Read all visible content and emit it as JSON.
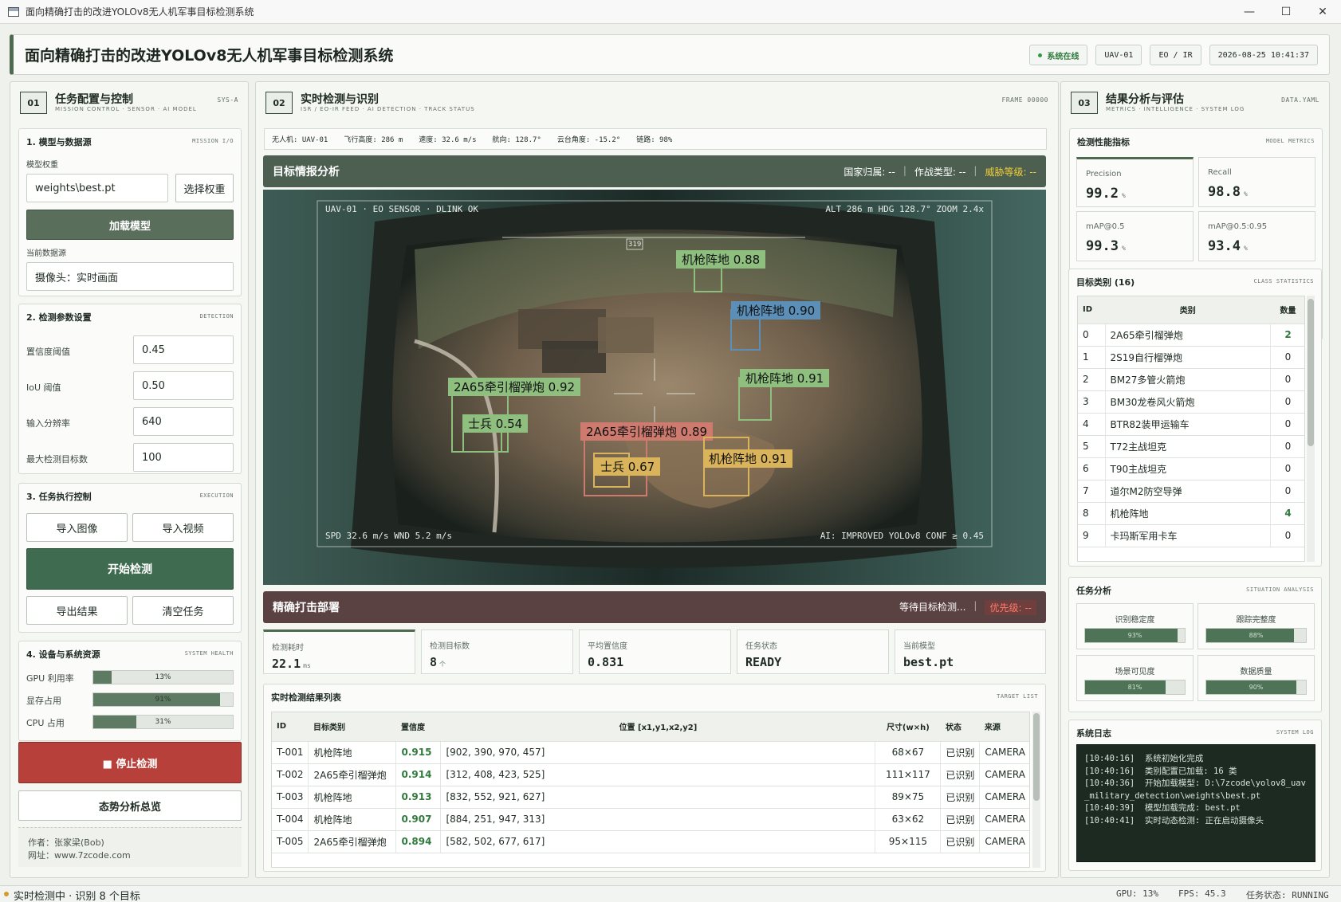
{
  "window": {
    "title": "面向精确打击的改进YOLOv8无人机军事目标检测系统"
  },
  "header": {
    "title": "面向精确打击的改进YOLOv8无人机军事目标检测系统",
    "status": "系统在线",
    "uav": "UAV-01",
    "sensor": "EO / IR",
    "datetime": "2026-08-25 10:41:37"
  },
  "left": {
    "num": "01",
    "title": "任务配置与控制",
    "subtitle": "MISSION CONTROL · SENSOR · AI MODEL",
    "tag": "SYS-A",
    "model": {
      "title": "1. 模型与数据源",
      "tag": "MISSION I/O",
      "weights_label": "模型权重",
      "weights_value": "weights\\best.pt",
      "choose_btn": "选择权重",
      "load_btn": "加载模型",
      "source_label": "当前数据源",
      "source_value": "摄像头：实时画面"
    },
    "params": {
      "title": "2. 检测参数设置",
      "tag": "DETECTION",
      "items": [
        {
          "label": "置信度阈值",
          "value": "0.45"
        },
        {
          "label": "IoU 阈值",
          "value": "0.50"
        },
        {
          "label": "输入分辨率",
          "value": "640"
        },
        {
          "label": "最大检测目标数",
          "value": "100"
        }
      ]
    },
    "exec": {
      "title": "3. 任务执行控制",
      "tag": "EXECUTION",
      "import_image": "导入图像",
      "import_video": "导入视频",
      "start": "开始检测",
      "export": "导出结果",
      "clear": "清空任务"
    },
    "device": {
      "title": "4. 设备与系统资源",
      "tag": "SYSTEM HEALTH",
      "items": [
        {
          "label": "GPU 利用率",
          "value": 0.13,
          "text": "13%"
        },
        {
          "label": "显存占用",
          "value": 0.91,
          "text": "91%"
        },
        {
          "label": "CPU 占用",
          "value": 0.31,
          "text": "31%"
        }
      ]
    },
    "stop_btn": "■ 停止检测",
    "overview_btn": "态势分析总览",
    "author": "作者：张家梁(Bob)",
    "website": "网址：www.7zcode.com"
  },
  "center": {
    "num": "02",
    "title": "实时检测与识别",
    "subtitle": "ISR / EO-IR FEED · AI DETECTION · TRACK STATUS",
    "tag": "FRAME 00000",
    "telemetry": [
      "无人机: UAV-01",
      "飞行高度: 286 m",
      "速度: 32.6 m/s",
      "航向: 128.7°",
      "云台角度: -15.2°",
      "链路: 98%"
    ],
    "intel": {
      "title": "目标情报分析",
      "nation": "国家归属: --",
      "combat": "作战类型: --",
      "threat": "威胁等级: --"
    },
    "hud": {
      "tl": "UAV-01 · EO SENSOR · DLINK OK",
      "tr": "ALT 286 m   HDG 128.7°   ZOOM 2.4x",
      "bl": "SPD 32.6 m/s   WND 5.2 m/s",
      "br": "AI: IMPROVED YOLOv8   CONF ≥ 0.45",
      "heading_box": "319"
    },
    "detections": [
      {
        "label": "机枪阵地  0.88",
        "color": "#8fbf7f"
      },
      {
        "label": "机枪阵地  0.90",
        "color": "#5b8fb7"
      },
      {
        "label": "机枪阵地  0.91",
        "color": "#8fbf7f"
      },
      {
        "label": "2A65牵引榴弹炮  0.92",
        "color": "#8fbf7f"
      },
      {
        "label": "士兵  0.54",
        "color": "#8fbf7f"
      },
      {
        "label": "2A65牵引榴弹炮  0.89",
        "color": "#cf7a6e"
      },
      {
        "label": "士兵  0.67",
        "color": "#d9b45a"
      },
      {
        "label": "机枪阵地  0.91",
        "color": "#d9b45a"
      }
    ],
    "strike": {
      "title": "精确打击部署",
      "waiting": "等待目标检测...",
      "priority": "优先级: --"
    },
    "stats": [
      {
        "k": "检测耗时",
        "v": "22.1",
        "u": "ms"
      },
      {
        "k": "检测目标数",
        "v": "8",
        "u": "个"
      },
      {
        "k": "平均置信度",
        "v": "0.831",
        "u": ""
      },
      {
        "k": "任务状态",
        "v": "READY",
        "u": ""
      },
      {
        "k": "当前模型",
        "v": "best.pt",
        "u": ""
      }
    ],
    "results": {
      "title": "实时检测结果列表",
      "tag": "TARGET LIST",
      "headers": [
        "ID",
        "目标类别",
        "置信度",
        "位置 [x1,y1,x2,y2]",
        "尺寸(w×h)",
        "状态",
        "来源"
      ],
      "rows": [
        [
          "T-001",
          "机枪阵地",
          "0.915",
          "[902, 390, 970, 457]",
          "68×67",
          "已识别",
          "CAMERA"
        ],
        [
          "T-002",
          "2A65牵引榴弹炮",
          "0.914",
          "[312, 408, 423, 525]",
          "111×117",
          "已识别",
          "CAMERA"
        ],
        [
          "T-003",
          "机枪阵地",
          "0.913",
          "[832, 552, 921, 627]",
          "89×75",
          "已识别",
          "CAMERA"
        ],
        [
          "T-004",
          "机枪阵地",
          "0.907",
          "[884, 251, 947, 313]",
          "63×62",
          "已识别",
          "CAMERA"
        ],
        [
          "T-005",
          "2A65牵引榴弹炮",
          "0.894",
          "[582, 502, 677, 617]",
          "95×115",
          "已识别",
          "CAMERA"
        ]
      ]
    }
  },
  "right": {
    "num": "03",
    "title": "结果分析与评估",
    "subtitle": "METRICS · INTELLIGENCE · SYSTEM LOG",
    "tag": "DATA.YAML",
    "metrics": {
      "title": "检测性能指标",
      "tag": "MODEL METRICS",
      "items": [
        {
          "k": "Precision",
          "v": "99.2",
          "u": "%"
        },
        {
          "k": "Recall",
          "v": "98.8",
          "u": "%"
        },
        {
          "k": "mAP@0.5",
          "v": "99.3",
          "u": "%"
        },
        {
          "k": "mAP@0.5:0.95",
          "v": "93.4",
          "u": "%"
        }
      ]
    },
    "classes": {
      "title": "目标类别 (16)",
      "tag": "CLASS STATISTICS",
      "headers": [
        "ID",
        "类别",
        "数量"
      ],
      "rows": [
        [
          "0",
          "2A65牵引榴弹炮",
          "2"
        ],
        [
          "1",
          "2S19自行榴弹炮",
          "0"
        ],
        [
          "2",
          "BM27多管火箭炮",
          "0"
        ],
        [
          "3",
          "BM30龙卷风火箭炮",
          "0"
        ],
        [
          "4",
          "BTR82装甲运输车",
          "0"
        ],
        [
          "5",
          "T72主战坦克",
          "0"
        ],
        [
          "6",
          "T90主战坦克",
          "0"
        ],
        [
          "7",
          "道尔M2防空导弹",
          "0"
        ],
        [
          "8",
          "机枪阵地",
          "4"
        ],
        [
          "9",
          "卡玛斯军用卡车",
          "0"
        ]
      ]
    },
    "situation": {
      "title": "任务分析",
      "tag": "SITUATION ANALYSIS",
      "items": [
        {
          "k": "识别稳定度",
          "v": 0.93,
          "text": "93%"
        },
        {
          "k": "跟踪完整度",
          "v": 0.88,
          "text": "88%"
        },
        {
          "k": "场景可见度",
          "v": 0.81,
          "text": "81%"
        },
        {
          "k": "数据质量",
          "v": 0.9,
          "text": "90%"
        }
      ]
    },
    "log": {
      "title": "系统日志",
      "tag": "SYSTEM LOG",
      "lines": [
        "[10:40:16]  系统初始化完成",
        "[10:40:16]  类别配置已加载: 16 类",
        "[10:40:36]  开始加载模型: D:\\7zcode\\yolov8_uav_military_detection\\weights\\best.pt",
        "[10:40:39]  模型加载完成: best.pt",
        "[10:40:41]  实时动态检测: 正在启动摄像头"
      ]
    }
  },
  "statusbar": {
    "left": "实时检测中 · 识别 8 个目标",
    "gpu": "GPU: 13%",
    "fps": "FPS: 45.3",
    "task": "任务状态: RUNNING"
  }
}
